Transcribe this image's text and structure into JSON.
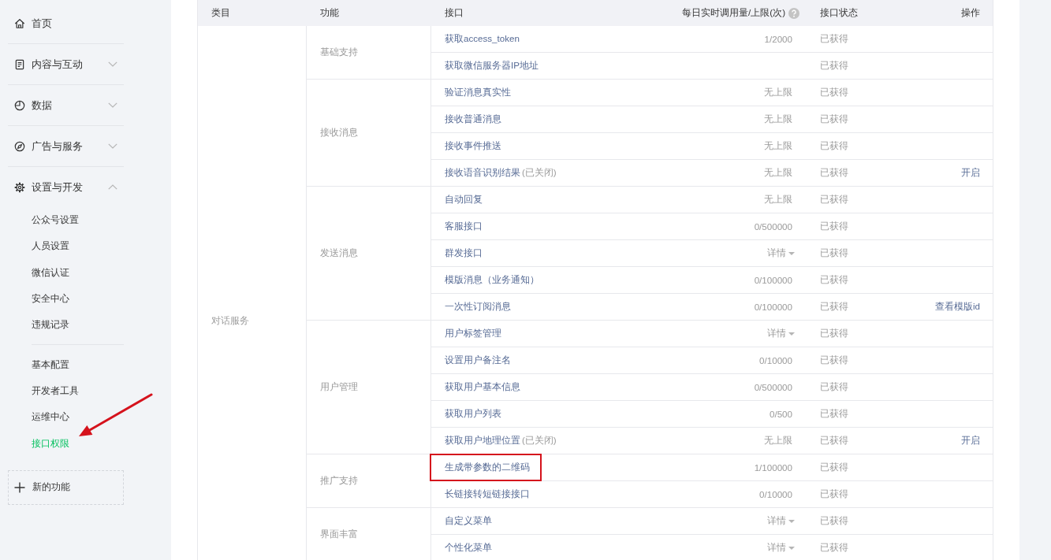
{
  "sidebar": {
    "items": [
      {
        "label": "首页",
        "kind": "link"
      },
      {
        "label": "内容与互动",
        "kind": "group",
        "expanded": false
      },
      {
        "label": "数据",
        "kind": "group",
        "expanded": false
      },
      {
        "label": "广告与服务",
        "kind": "group",
        "expanded": false
      },
      {
        "label": "设置与开发",
        "kind": "group",
        "expanded": true,
        "sections": [
          {
            "items": [
              {
                "label": "公众号设置",
                "selected": false,
                "arrow_annotation": false
              },
              {
                "label": "人员设置",
                "selected": false,
                "arrow_annotation": false
              },
              {
                "label": "微信认证",
                "selected": false,
                "arrow_annotation": false
              },
              {
                "label": "安全中心",
                "selected": false,
                "arrow_annotation": false
              },
              {
                "label": "违规记录",
                "selected": false,
                "arrow_annotation": false
              }
            ]
          },
          {
            "items": [
              {
                "label": "基本配置",
                "selected": false,
                "arrow_annotation": false
              },
              {
                "label": "开发者工具",
                "selected": false,
                "arrow_annotation": false
              },
              {
                "label": "运维中心",
                "selected": false,
                "arrow_annotation": false
              },
              {
                "label": "接口权限",
                "selected": true,
                "arrow_annotation": true
              }
            ]
          }
        ]
      }
    ],
    "add_button": {
      "label": "新的功能"
    }
  },
  "table": {
    "columns": [
      {
        "label": "类目",
        "help": false
      },
      {
        "label": "功能",
        "help": false
      },
      {
        "label": "接口",
        "help": false
      },
      {
        "label": "每日实时调用量/上限(次)",
        "help": true
      },
      {
        "label": "接口状态",
        "help": false
      },
      {
        "label": "操作",
        "help": false
      }
    ],
    "categories": [
      {
        "name": "对话服务",
        "groups": [
          {
            "name": "基础支持",
            "rows": [
              {
                "name": "获取access_token",
                "quota": "1/2000",
                "quota_dropdown": false,
                "status": "已获得",
                "highlighted": false
              },
              {
                "name": "获取微信服务器IP地址",
                "quota_dropdown": false,
                "status": "已获得",
                "highlighted": false
              }
            ]
          },
          {
            "name": "接收消息",
            "rows": [
              {
                "name": "验证消息真实性",
                "quota": "无上限",
                "quota_dropdown": false,
                "status": "已获得",
                "highlighted": false
              },
              {
                "name": "接收普通消息",
                "quota": "无上限",
                "quota_dropdown": false,
                "status": "已获得",
                "highlighted": false
              },
              {
                "name": "接收事件推送",
                "quota": "无上限",
                "quota_dropdown": false,
                "status": "已获得",
                "highlighted": false
              },
              {
                "name": "接收语音识别结果",
                "note": "(已关闭)",
                "quota": "无上限",
                "quota_dropdown": false,
                "status": "已获得",
                "action": "开启",
                "highlighted": false
              }
            ]
          },
          {
            "name": "发送消息",
            "rows": [
              {
                "name": "自动回复",
                "quota": "无上限",
                "quota_dropdown": false,
                "status": "已获得",
                "highlighted": false
              },
              {
                "name": "客服接口",
                "quota": "0/500000",
                "quota_dropdown": false,
                "status": "已获得",
                "highlighted": false
              },
              {
                "name": "群发接口",
                "quota": "详情",
                "quota_dropdown": true,
                "status": "已获得",
                "highlighted": false
              },
              {
                "name": "模版消息（业务通知）",
                "quota": "0/100000",
                "quota_dropdown": false,
                "status": "已获得",
                "highlighted": false
              },
              {
                "name": "一次性订阅消息",
                "quota": "0/100000",
                "quota_dropdown": false,
                "status": "已获得",
                "action": "查看模版id",
                "highlighted": false
              }
            ]
          },
          {
            "name": "用户管理",
            "rows": [
              {
                "name": "用户标签管理",
                "quota": "详情",
                "quota_dropdown": true,
                "status": "已获得",
                "highlighted": false
              },
              {
                "name": "设置用户备注名",
                "quota": "0/10000",
                "quota_dropdown": false,
                "status": "已获得",
                "highlighted": false
              },
              {
                "name": "获取用户基本信息",
                "quota": "0/500000",
                "quota_dropdown": false,
                "status": "已获得",
                "highlighted": false
              },
              {
                "name": "获取用户列表",
                "quota": "0/500",
                "quota_dropdown": false,
                "status": "已获得",
                "highlighted": false
              },
              {
                "name": "获取用户地理位置",
                "note": "(已关闭)",
                "quota": "无上限",
                "quota_dropdown": false,
                "status": "已获得",
                "action": "开启",
                "highlighted": false
              }
            ]
          },
          {
            "name": "推广支持",
            "rows": [
              {
                "name": "生成带参数的二维码",
                "quota": "1/100000",
                "quota_dropdown": false,
                "status": "已获得",
                "highlighted": true
              },
              {
                "name": "长链接转短链接接口",
                "quota": "0/10000",
                "quota_dropdown": false,
                "status": "已获得",
                "highlighted": false
              }
            ]
          },
          {
            "name": "界面丰富",
            "rows": [
              {
                "name": "自定义菜单",
                "quota": "详情",
                "quota_dropdown": true,
                "status": "已获得",
                "highlighted": false
              },
              {
                "name": "个性化菜单",
                "quota": "详情",
                "quota_dropdown": true,
                "status": "已获得",
                "highlighted": false
              }
            ]
          }
        ]
      }
    ]
  }
}
